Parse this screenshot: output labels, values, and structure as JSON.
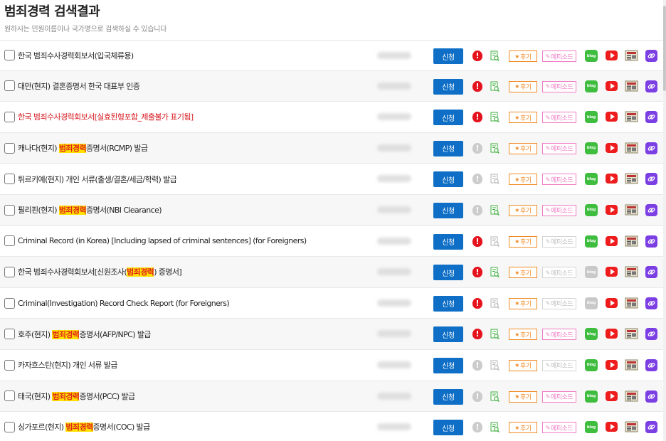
{
  "header": {
    "title": "범죄경력 검색결과",
    "subtitle": "원하시는 민원이름이나 국가명으로 검색하실 수 있습니다"
  },
  "buttons": {
    "apply": "신청",
    "review": "후기",
    "episode": "에피소드",
    "blog": "blog",
    "warn_mark": "!"
  },
  "colors": {
    "apply": "#0f6fc6",
    "warn_active": "#e5131d",
    "review": "#f08a24",
    "episode": "#f07cc4",
    "blog": "#3fbd3f",
    "youtube": "#ee1c1c",
    "link": "#7b3fe4",
    "highlight_bg": "#ffe100",
    "highlight_text": "#e0241b",
    "red_title": "#d7191f"
  },
  "icons": [
    "checkbox",
    "warning-icon",
    "document-search-icon",
    "star-icon",
    "pencil-icon",
    "blog-icon",
    "youtube-icon",
    "news-icon",
    "link-icon"
  ],
  "rows": [
    {
      "pre": "한국 범죄수사경력회보서(입국체류용)",
      "hl": "",
      "post": "",
      "red": false,
      "warn": true,
      "doc": true,
      "episode": true,
      "blog": true
    },
    {
      "pre": "대만(현지) 결혼증명서 한국 대표부 인증",
      "hl": "",
      "post": "",
      "red": false,
      "warn": true,
      "doc": true,
      "episode": true,
      "blog": true
    },
    {
      "pre": "한국 범죄수사경력회보서[실효된형포함_제출불가 표기됨]",
      "hl": "",
      "post": "",
      "red": true,
      "warn": true,
      "doc": true,
      "episode": true,
      "blog": true
    },
    {
      "pre": "캐나다(현지) ",
      "hl": "범죄경력",
      "post": "증명서(RCMP) 발급",
      "red": false,
      "warn": false,
      "doc": true,
      "episode": true,
      "blog": true
    },
    {
      "pre": "튀르키예(현지) 개인 서류(출생/결혼/세금/학력) 발급",
      "hl": "",
      "post": "",
      "red": false,
      "warn": false,
      "doc": false,
      "episode": true,
      "blog": true
    },
    {
      "pre": "필리핀(현지) ",
      "hl": "범죄경력",
      "post": "증명서(NBI Clearance)",
      "red": false,
      "warn": false,
      "doc": true,
      "episode": true,
      "blog": true
    },
    {
      "pre": "Criminal Record (in Korea) [Including lapsed of criminal sentences] (for Foreigners)",
      "hl": "",
      "post": "",
      "red": false,
      "warn": true,
      "doc": false,
      "episode": false,
      "blog": true
    },
    {
      "pre": "한국 범죄수사경력회보서[신원조사(",
      "hl": "범죄경력",
      "post": ") 증명서]",
      "red": false,
      "warn": true,
      "doc": true,
      "episode": false,
      "blog": false
    },
    {
      "pre": "Criminal(Investigation) Record Check Report (for Foreigners)",
      "hl": "",
      "post": "",
      "red": false,
      "warn": true,
      "doc": false,
      "episode": false,
      "blog": false
    },
    {
      "pre": "호주(현지) ",
      "hl": "범죄경력",
      "post": "증명서(AFP/NPC) 발급",
      "red": false,
      "warn": true,
      "doc": true,
      "episode": true,
      "blog": true
    },
    {
      "pre": "카자흐스탄(현지) 개인 서류 발급",
      "hl": "",
      "post": "",
      "red": false,
      "warn": false,
      "doc": false,
      "episode": false,
      "blog": true
    },
    {
      "pre": "태국(현지) ",
      "hl": "범죄경력",
      "post": "증명서(PCC) 발급",
      "red": false,
      "warn": false,
      "doc": true,
      "episode": true,
      "blog": true
    },
    {
      "pre": "싱가포르(현지) ",
      "hl": "범죄경력",
      "post": "증명서(COC) 발급",
      "red": false,
      "warn": false,
      "doc": true,
      "episode": true,
      "blog": true
    }
  ]
}
